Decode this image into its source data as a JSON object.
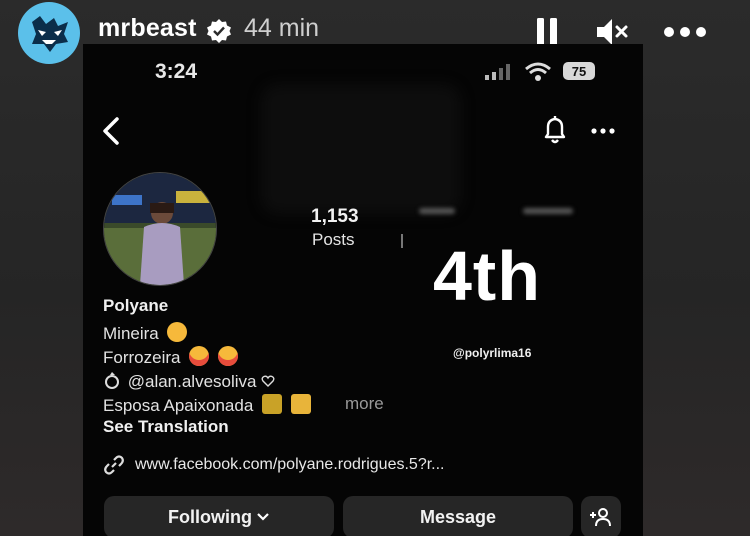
{
  "story": {
    "username": "mrbeast",
    "posted_ago": "44 min",
    "icons": {
      "avatar": "mrbeast-logo-icon",
      "verified": "verified-badge-icon",
      "pause": "pause-icon",
      "mute": "mute-icon",
      "more": "more-horizontal-icon"
    }
  },
  "phone_status": {
    "time": "3:24",
    "battery": "75"
  },
  "profile": {
    "posts_count": "1,153",
    "posts_label": "Posts",
    "name": "Polyane",
    "bio": {
      "line1": "Mineira",
      "line2": "Forrozeira",
      "line3_mention": "@alan.alvesoliva",
      "line4": "Esposa Apaixonada",
      "more": "more",
      "see_translation": "See Translation"
    },
    "link": "www.facebook.com/polyane.rodrigues.5?r...",
    "buttons": {
      "following": "Following",
      "message": "Message"
    }
  },
  "sticker": {
    "rank": "4th",
    "mention": "@polyrlima16"
  },
  "colors": {
    "story_avatar_bg": "#5bc0ea",
    "phone_bg": "#050505",
    "button_bg": "#262626",
    "emoji_yellow": "#f6b93b",
    "emoji_red": "#e74c3c"
  }
}
